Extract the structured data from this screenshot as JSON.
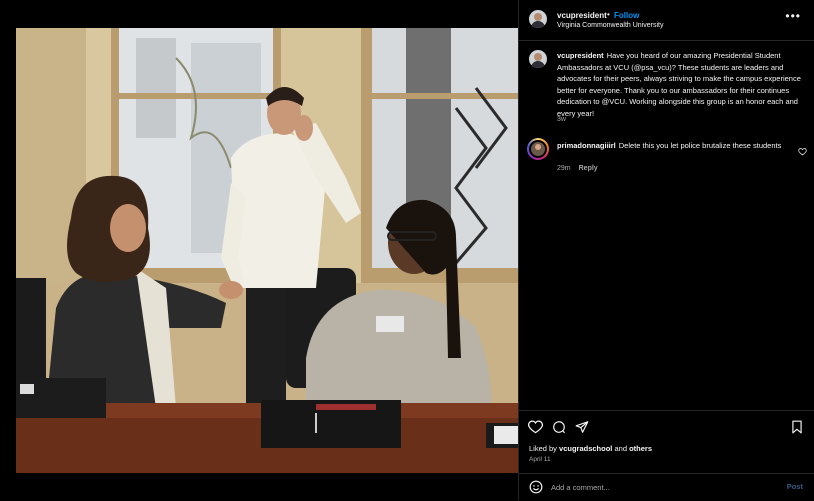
{
  "post": {
    "username": "vcupresident",
    "separator": "•",
    "follow_label": "Follow",
    "location": "Virginia Commonwealth University",
    "more_label": "•••",
    "caption": "Have you heard of our amazing Presidential Student Ambassadors at VCU (@psa_vcu)? These students are leaders and advocates for their peers, always striving to make the campus experience better for everyone. Thank you to our ambassadors for their continues dedication to @VCU. Working alongside this group is an honor each and every year!",
    "caption_time": "3w"
  },
  "comments": [
    {
      "username": "primadonnagiiirl",
      "text": "Delete this you let police brutalize these students",
      "time": "29m",
      "reply_label": "Reply"
    }
  ],
  "actions": {
    "like_icon": "heart-icon",
    "comment_icon": "comment-icon",
    "share_icon": "share-icon",
    "save_icon": "bookmark-icon"
  },
  "likes": {
    "prefix": "Liked by",
    "user": "vcugradschool",
    "middle": "and",
    "others": "others"
  },
  "date": "April 11",
  "add_comment": {
    "placeholder": "Add a comment...",
    "post_label": "Post"
  },
  "colors": {
    "background": "#000000",
    "link": "#0095f6",
    "muted": "#a8a8a8",
    "post_disabled": "#3a5b84"
  }
}
